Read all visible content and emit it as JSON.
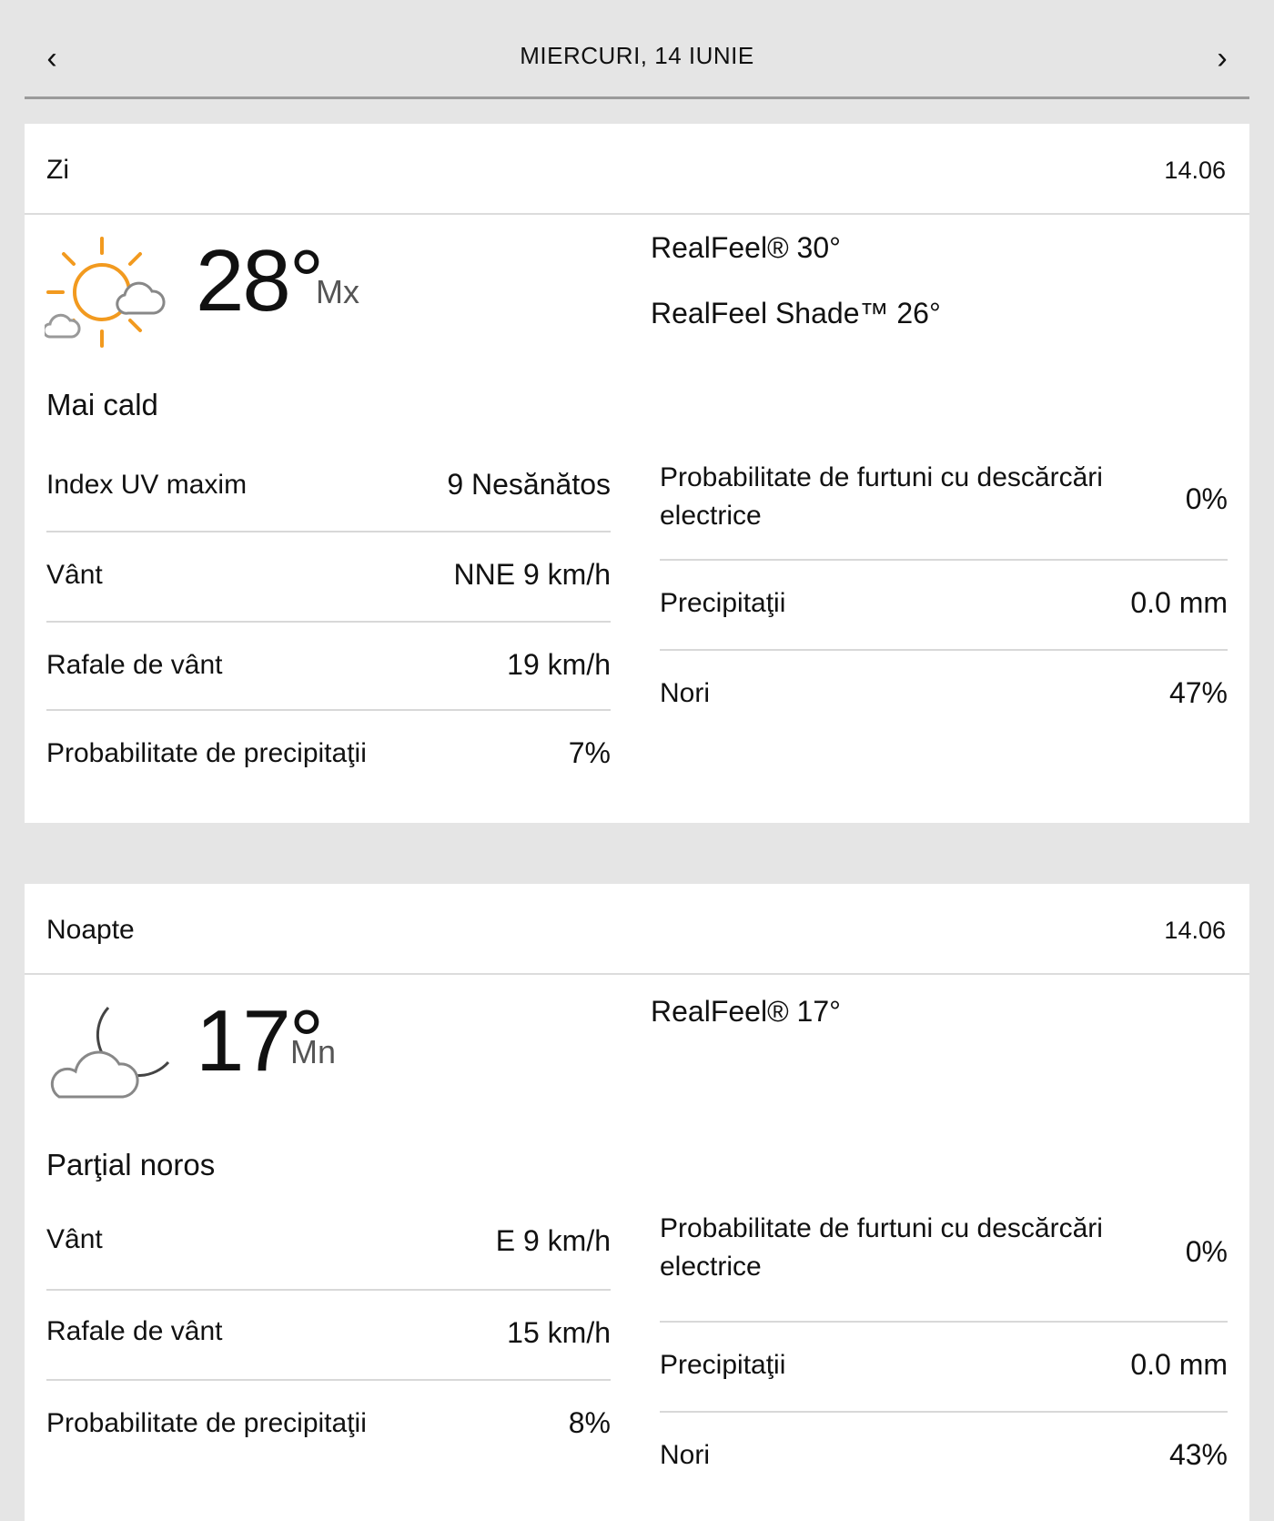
{
  "nav": {
    "date_title": "MIERCURI, 14 IUNIE",
    "prev_icon": "chevron-left-icon",
    "next_icon": "chevron-right-icon"
  },
  "day": {
    "title": "Zi",
    "date": "14.06",
    "icon": "partly-sunny-icon",
    "temp": "28°",
    "temp_unit": "Mx",
    "realfeel": "RealFeel® 30°",
    "realfeel_shade": "RealFeel Shade™ 26°",
    "phrase": "Mai cald",
    "left": [
      {
        "label": "Index UV maxim",
        "value": "9 Nesănătos"
      },
      {
        "label": "Vânt",
        "value": "NNE 9 km/h"
      },
      {
        "label": "Rafale de vânt",
        "value": "19 km/h"
      },
      {
        "label": "Probabilitate de precipitaţii",
        "value": "7%"
      }
    ],
    "right": [
      {
        "label": "Probabilitate de furtuni cu descărcări electrice",
        "value": "0%"
      },
      {
        "label": "Precipitaţii",
        "value": "0.0 mm"
      },
      {
        "label": "Nori",
        "value": "47%"
      }
    ]
  },
  "night": {
    "title": "Noapte",
    "date": "14.06",
    "icon": "partly-cloudy-night-icon",
    "temp": "17°",
    "temp_unit": "Mn",
    "realfeel": "RealFeel® 17°",
    "phrase": "Parţial noros",
    "left": [
      {
        "label": "Vânt",
        "value": "E 9 km/h"
      },
      {
        "label": "Rafale de vânt",
        "value": "15 km/h"
      },
      {
        "label": "Probabilitate de precipitaţii",
        "value": "8%"
      }
    ],
    "right": [
      {
        "label": "Probabilitate de furtuni cu descărcări electrice",
        "value": "0%"
      },
      {
        "label": "Precipitaţii",
        "value": "0.0 mm"
      },
      {
        "label": "Nori",
        "value": "43%"
      }
    ]
  }
}
